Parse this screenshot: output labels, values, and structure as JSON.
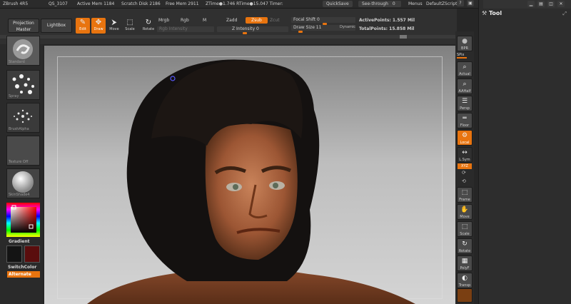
{
  "status": {
    "app": "ZBrush 4R5",
    "doc": "QS_3107",
    "active_mem": "Active Mem 1184",
    "scratch": "Scratch Disk 2186",
    "free_mem": "Free Mem 2911",
    "ztime": "ZTime●1.746 RTime●15.047 Timer:",
    "quicksave": "QuickSave",
    "see_through": "See-through",
    "see_through_value": "0",
    "menus": "Menus",
    "script": "DefaultZScript"
  },
  "toolbar": {
    "projection_master": "Projection Master",
    "lightbox": "LightBox",
    "tools": [
      {
        "label": "Edit",
        "glyph": "✎"
      },
      {
        "label": "Draw",
        "glyph": "✥"
      },
      {
        "label": "Move",
        "glyph": "⮞"
      },
      {
        "label": "Scale",
        "glyph": "⬚"
      },
      {
        "label": "Rotate",
        "glyph": "↻"
      }
    ],
    "mrgb": "Mrgb",
    "rgb": "Rgb",
    "m": "M",
    "zadd": "Zadd",
    "zsub": "Zsub",
    "zcut": "Zcut",
    "rgb_intensity": "Rgb Intensity",
    "z_intensity": "Z Intensity 0",
    "focal_shift": "Focal Shift 0",
    "draw_size": "Draw Size 11",
    "dynamic": "Dynamic",
    "active_points": "ActivePoints: 1.557 Mil",
    "total_points": "TotalPoints: 15.858 Mil"
  },
  "left_shelf": {
    "brush": "Standard",
    "stroke": "Spray",
    "alpha": "BrushAlpha",
    "texture": "Texture Off",
    "material": "SkinShade4",
    "gradient": "Gradient",
    "switch_color": "SwitchColor",
    "alternate": "Alternate"
  },
  "right_shelf": [
    {
      "label": "BPR",
      "glyph": "●"
    },
    {
      "label": "SPix",
      "glyph": ""
    },
    {
      "label": "Actual",
      "glyph": "⌕"
    },
    {
      "label": "AAHalf",
      "glyph": "⌕"
    },
    {
      "label": "Persp",
      "glyph": "☰"
    },
    {
      "label": "Floor",
      "glyph": "═"
    },
    {
      "label": "Local",
      "glyph": "⚙"
    },
    {
      "label": "L.Sym",
      "glyph": "↔"
    },
    {
      "label": "XYZ",
      "glyph": ""
    },
    {
      "label": "Frame",
      "glyph": "⬚"
    },
    {
      "label": "Move",
      "glyph": "✋"
    },
    {
      "label": "Scale",
      "glyph": "⬚"
    },
    {
      "label": "Rotate",
      "glyph": "↻"
    },
    {
      "label": "PolyF",
      "glyph": "▦"
    },
    {
      "label": "Transp",
      "glyph": "◐"
    }
  ],
  "tool_panel": {
    "title": "Tool"
  },
  "colors": {
    "accent": "#e8740f",
    "main_color": "#141414",
    "secondary_color": "#5a0d0d"
  }
}
